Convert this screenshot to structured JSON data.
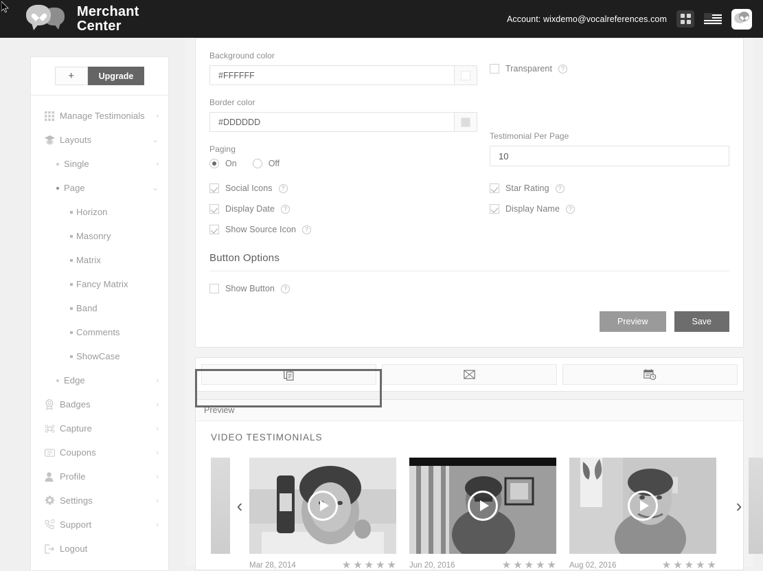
{
  "topbar": {
    "brand_line1": "Merchant",
    "brand_line2": "Center",
    "account_label": "Account: wixdemo@vocalreferences.com",
    "icons": [
      "grid-icon",
      "flag-icon",
      "app-logo-icon"
    ]
  },
  "sidebar": {
    "plus_label": "+",
    "upgrade_label": "Upgrade",
    "items": [
      {
        "label": "Manage Testimonials",
        "icon": "grid-icon",
        "level": 0,
        "arrow": "›"
      },
      {
        "label": "Layouts",
        "icon": "layers-icon",
        "level": 0,
        "arrow": "⌄"
      },
      {
        "label": "Single",
        "icon": "bullet-icon",
        "level": 1,
        "arrow": "›"
      },
      {
        "label": "Page",
        "icon": "bullet-icon",
        "level": 1,
        "arrow": "⌄"
      },
      {
        "label": "Horizon",
        "icon": "bullet-icon",
        "level": 2,
        "arrow": ""
      },
      {
        "label": "Masonry",
        "icon": "bullet-icon",
        "level": 2,
        "arrow": ""
      },
      {
        "label": "Matrix",
        "icon": "bullet-icon",
        "level": 2,
        "arrow": ""
      },
      {
        "label": "Fancy Matrix",
        "icon": "bullet-icon",
        "level": 2,
        "arrow": ""
      },
      {
        "label": "Band",
        "icon": "bullet-icon",
        "level": 2,
        "arrow": ""
      },
      {
        "label": "Comments",
        "icon": "bullet-icon",
        "level": 2,
        "arrow": ""
      },
      {
        "label": "ShowCase",
        "icon": "bullet-icon",
        "level": 2,
        "arrow": ""
      },
      {
        "label": "Edge",
        "icon": "bullet-icon",
        "level": 1,
        "arrow": "›"
      },
      {
        "label": "Badges",
        "icon": "badge-icon",
        "level": 0,
        "arrow": "›"
      },
      {
        "label": "Capture",
        "icon": "capture-icon",
        "level": 0,
        "arrow": "›"
      },
      {
        "label": "Coupons",
        "icon": "coupon-icon",
        "level": 0,
        "arrow": "›"
      },
      {
        "label": "Profile",
        "icon": "user-icon",
        "level": 0,
        "arrow": "›"
      },
      {
        "label": "Settings",
        "icon": "gear-icon",
        "level": 0,
        "arrow": "›"
      },
      {
        "label": "Support",
        "icon": "phone-icon",
        "level": 0,
        "arrow": "›"
      },
      {
        "label": "Logout",
        "icon": "logout-icon",
        "level": 0,
        "arrow": ""
      }
    ]
  },
  "settings": {
    "background_color": {
      "label": "Background color",
      "value": "#FFFFFF",
      "swatch": "#FFFFFF"
    },
    "border_color": {
      "label": "Border color",
      "value": "#DDDDDD",
      "swatch": "#DDDDDD"
    },
    "transparent": {
      "label": "Transparent",
      "checked": false
    },
    "paging": {
      "label": "Paging",
      "on_label": "On",
      "off_label": "Off",
      "selected": "On"
    },
    "testimonial_per_page": {
      "label": "Testimonial Per Page",
      "value": "10"
    },
    "options": [
      {
        "label": "Social Icons",
        "checked": true
      },
      {
        "label": "Star Rating",
        "checked": true
      },
      {
        "label": "Display Date",
        "checked": true
      },
      {
        "label": "Display Name",
        "checked": true
      },
      {
        "label": "Show Source Icon",
        "checked": true
      }
    ],
    "button_options_title": "Button Options",
    "show_button": {
      "label": "Show Button",
      "checked": false
    },
    "preview_label": "Preview",
    "save_label": "Save"
  },
  "tabs": [
    {
      "name": "embed-code-tab",
      "icon": "copy-icon",
      "active": true
    },
    {
      "name": "email-tab",
      "icon": "envelope-icon",
      "active": false
    },
    {
      "name": "schedule-tab",
      "icon": "calendar-clock-icon",
      "active": false
    }
  ],
  "preview": {
    "header_label": "Preview",
    "title": "VIDEO TESTIMONIALS",
    "prev_arrow": "‹",
    "next_arrow": "›",
    "videos": [
      {
        "date": "Mar 28, 2014",
        "stars": 5,
        "letterbox": false
      },
      {
        "date": "Jun 20, 2016",
        "stars": 5,
        "letterbox": true
      },
      {
        "date": "Aug 02, 2016",
        "stars": 5,
        "letterbox": false
      }
    ]
  },
  "colors": {
    "topbar_bg": "#1e1e1e",
    "page_bg": "#f0f0f0",
    "panel_bg": "#f3f3f3",
    "save_btn": "#6d6d6d",
    "preview_btn": "#9a9a9a",
    "focus_ring": "#6a6a6a"
  }
}
